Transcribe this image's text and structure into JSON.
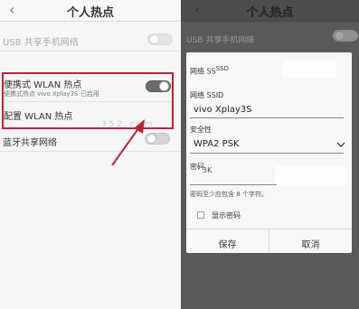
{
  "left": {
    "title": "个人热点",
    "back_icon": "chevron-left-icon",
    "usb_label": "USB 共享手机网络",
    "wlan_label": "便携式 WLAN 热点",
    "wlan_sub": "便携式热点 vivo Xplay3S 已启用",
    "config_label": "配置 WLAN 热点",
    "bt_label": "蓝牙共享网络",
    "watermark": "3 5 2 . c o m",
    "highlight_color": "#b6263a"
  },
  "right": {
    "title": "个人热点",
    "back_icon": "chevron-left-icon",
    "usb_label": "USB 共享手机网络",
    "dialog": {
      "ssid_header_prefix": "网络 SS",
      "ssid_header_suffix": "SSD",
      "ssid_label": "网络 SSID",
      "ssid_value": "vivo Xplay3S",
      "security_label": "安全性",
      "security_value": "WPA2 PSK",
      "password_label": "密码",
      "password_overlay": "3K",
      "hint": "密码至少应包含 8 个字符。",
      "show_password_label": "显示密码",
      "save_label": "保存",
      "cancel_label": "取消"
    }
  }
}
